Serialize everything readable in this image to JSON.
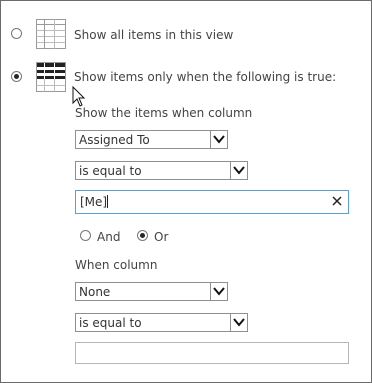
{
  "options": {
    "show_all_label": "Show all items in this view",
    "show_filtered_label": "Show items only when the following is true:"
  },
  "filter": {
    "instruction": "Show the items when column",
    "column1": "Assigned To",
    "operator1": "is equal to",
    "value1": "[Me]",
    "and_label": "And",
    "or_label": "Or",
    "when_column_label": "When column",
    "column2": "None",
    "operator2": "is equal to",
    "value2": ""
  },
  "icons": {
    "all_items": "table-grid-icon",
    "filtered_items": "filtered-table-icon",
    "arrow": "chevron-down-icon",
    "clear": "close-icon",
    "pointer": "mouse-cursor-icon"
  }
}
